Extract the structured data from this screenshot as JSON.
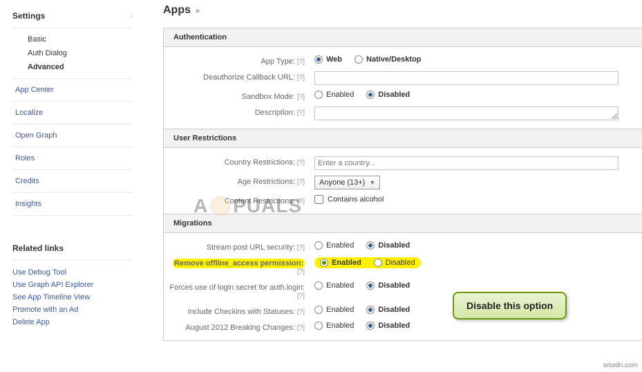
{
  "sidebar": {
    "settings_label": "Settings",
    "sub": {
      "basic": "Basic",
      "auth": "Auth Dialog",
      "advanced": "Advanced"
    },
    "nav": [
      "App Center",
      "Localize",
      "Open Graph",
      "Roles",
      "Credits",
      "Insights"
    ],
    "related_header": "Related links",
    "related": [
      "Use Debug Tool",
      "Use Graph API Explorer",
      "See App Timeline View",
      "Promote with an Ad",
      "Delete App"
    ]
  },
  "breadcrumb": {
    "apps": "Apps"
  },
  "auth": {
    "header": "Authentication",
    "app_type_label": "App Type:",
    "web": "Web",
    "native": "Native/Desktop",
    "deauth_label": "Deauthorize Callback URL:",
    "deauth_value": "",
    "sandbox_label": "Sandbox Mode:",
    "enabled": "Enabled",
    "disabled": "Disabled",
    "desc_label": "Description:",
    "desc_value": ""
  },
  "restrict": {
    "header": "User Restrictions",
    "country_label": "Country Restrictions:",
    "country_placeholder": "Enter a country...",
    "age_label": "Age Restrictions:",
    "age_value": "Anyone (13+)",
    "content_label": "Content Restrictions:",
    "content_value": "Contains alcohol"
  },
  "migrations": {
    "header": "Migrations",
    "enabled": "Enabled",
    "disabled": "Disabled",
    "rows": [
      "Stream post URL security:",
      "Remove offline_access permission:",
      "Forces use of login secret for auth.login:",
      "Include Checkins with Statuses:",
      "August 2012 Breaking Changes:"
    ]
  },
  "help_marker": "[?]",
  "callout": "Disable this option",
  "watermark": {
    "a": "A",
    "rest": "PUALS"
  },
  "source": "wsxdn.com"
}
